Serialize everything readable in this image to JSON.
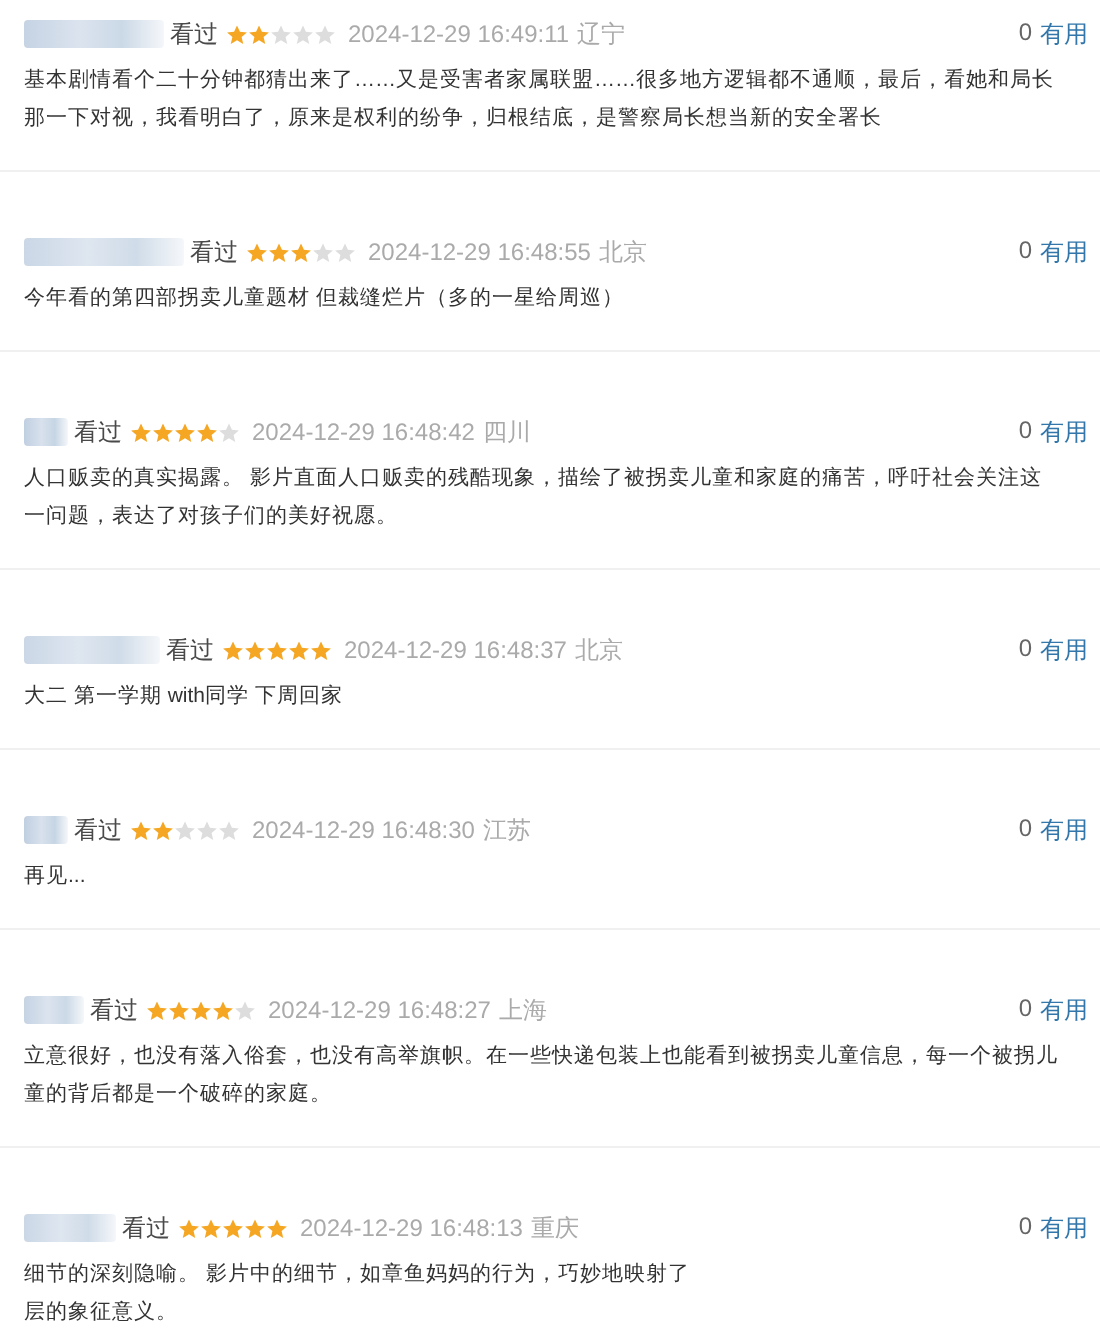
{
  "reviews": [
    {
      "status": "看过",
      "stars": 2,
      "time": "2024-12-29 16:49:11",
      "location": "辽宁",
      "count": "0",
      "useful": "有用",
      "lines": [
        "基本剧情看个二十分钟都猜出来了……又是受害者家属联盟……很多地方逻辑都不通顺，最后，看她和局长",
        "那一下对视，我看明白了，原来是权利的纷争，归根结底，是警察局长想当新的安全署长"
      ]
    },
    {
      "status": "看过",
      "stars": 3,
      "time": "2024-12-29 16:48:55",
      "location": "北京",
      "count": "0",
      "useful": "有用",
      "lines": [
        "今年看的第四部拐卖儿童题材 但裁缝烂片（多的一星给周巡）"
      ]
    },
    {
      "status": "看过",
      "stars": 4,
      "time": "2024-12-29 16:48:42",
      "location": "四川",
      "count": "0",
      "useful": "有用",
      "lines": [
        "人口贩卖的真实揭露。 影片直面人口贩卖的残酷现象，描绘了被拐卖儿童和家庭的痛苦，呼吁社会关注这",
        "一问题，表达了对孩子们的美好祝愿。"
      ]
    },
    {
      "status": "看过",
      "stars": 5,
      "time": "2024-12-29 16:48:37",
      "location": "北京",
      "count": "0",
      "useful": "有用",
      "lines": [
        "大二 第一学期 with同学 下周回家"
      ]
    },
    {
      "status": "看过",
      "stars": 2,
      "time": "2024-12-29 16:48:30",
      "location": "江苏",
      "count": "0",
      "useful": "有用",
      "lines": [
        "再见..."
      ]
    },
    {
      "status": "看过",
      "stars": 4,
      "time": "2024-12-29 16:48:27",
      "location": "上海",
      "count": "0",
      "useful": "有用",
      "lines": [
        "立意很好，也没有落入俗套，也没有高举旗帜。在一些快递包装上也能看到被拐卖儿童信息，每一个被拐儿",
        "童的背后都是一个破碎的家庭。"
      ]
    },
    {
      "status": "看过",
      "stars": 5,
      "time": "2024-12-29 16:48:13",
      "location": "重庆",
      "count": "0",
      "useful": "有用",
      "lines": [
        "细节的深刻隐喻。 影片中的细节，如章鱼妈妈的行为，巧妙地映射了",
        "层的象征意义。"
      ]
    }
  ]
}
